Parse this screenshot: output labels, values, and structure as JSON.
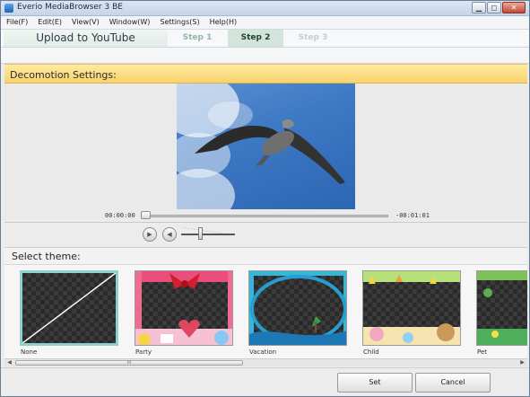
{
  "window": {
    "title": "Everio MediaBrowser 3 BE",
    "minimize": "▁",
    "maximize": "◻",
    "close": "✕"
  },
  "menu": [
    "File(F)",
    "Edit(E)",
    "View(V)",
    "Window(W)",
    "Settings(S)",
    "Help(H)"
  ],
  "steps": {
    "upload": "Upload to YouTube",
    "step1": "Step 1",
    "step2": "Step 2",
    "step3": "Step 3",
    "active": "Step 2"
  },
  "section_title": "Decomotion Settings:",
  "player": {
    "time_start": "00:00:00",
    "time_end": "-00:01:01",
    "progress": 0.0,
    "volume": 0.35
  },
  "theme_header": "Select theme:",
  "themes": [
    {
      "label": "None",
      "selected": true
    },
    {
      "label": "Party",
      "selected": false
    },
    {
      "label": "Vacation",
      "selected": false
    },
    {
      "label": "Child",
      "selected": false
    },
    {
      "label": "Pet",
      "selected": false
    }
  ],
  "scroll": {
    "handle_glyph": "III"
  },
  "buttons": {
    "set": "Set",
    "cancel": "Cancel"
  },
  "colors": {
    "section_header": "#f9d36b",
    "selected_theme_border": "#8ed2d0",
    "active_step": "#d3e4db"
  }
}
